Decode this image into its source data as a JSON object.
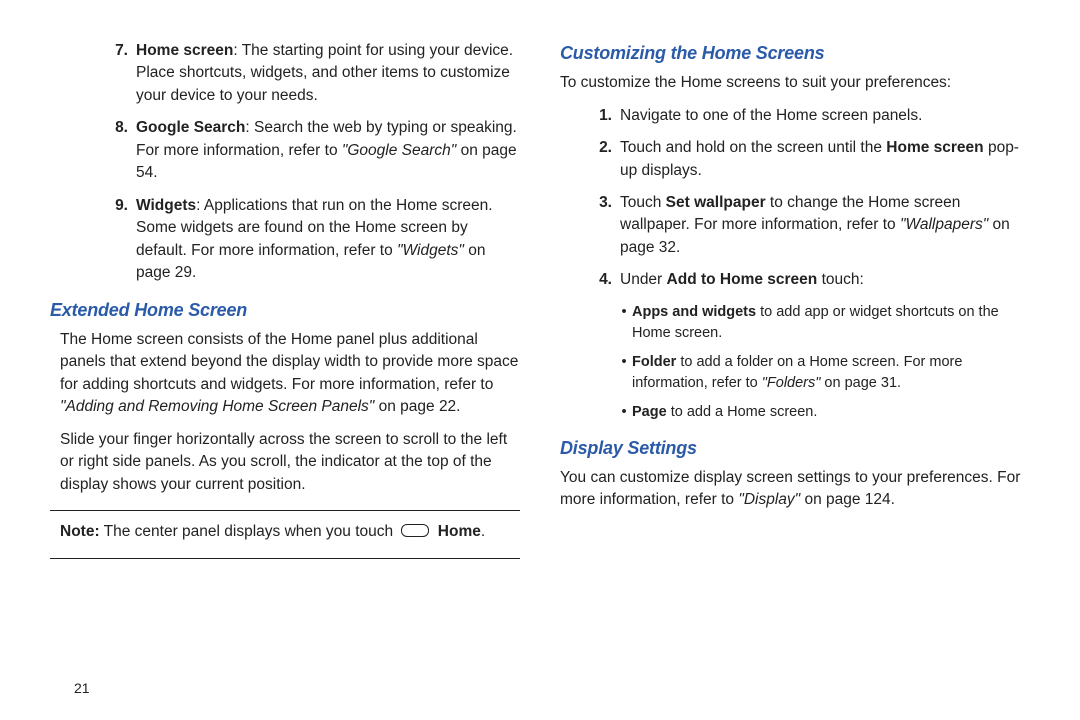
{
  "left": {
    "items": [
      {
        "num": "7.",
        "term": "Home screen",
        "text": ": The starting point for using your device. Place shortcuts, widgets, and other items to customize your device to your needs."
      },
      {
        "num": "8.",
        "term": "Google Search",
        "text1": ": Search the web by typing or speaking. For more information, refer to ",
        "ref": "\"Google Search\"",
        "text2": " on page 54."
      },
      {
        "num": "9.",
        "term": "Widgets",
        "text1": ": Applications that run on the Home screen. Some widgets are found on the Home screen by default. For more information, refer to ",
        "ref": "\"Widgets\"",
        "text2": " on page 29."
      }
    ],
    "h_extended": "Extended Home Screen",
    "p_ext1a": "The Home screen consists of the Home panel plus additional panels that extend beyond the display width to provide more space for adding shortcuts and widgets. For more information, refer to ",
    "p_ext1_ref": "\"Adding and Removing Home Screen Panels\"",
    "p_ext1b": " on page 22.",
    "p_ext2": "Slide your finger horizontally across the screen to scroll to the left or right side panels. As you scroll, the indicator at the top of the display shows your current position.",
    "note_label": "Note:",
    "note_text1": " The center panel displays when you touch ",
    "note_home": "Home",
    "note_text2": "."
  },
  "right": {
    "h_custom": "Customizing the Home Screens",
    "p_custom_intro": "To customize the Home screens to suit your preferences:",
    "steps": [
      {
        "num": "1.",
        "text": "Navigate to one of the Home screen panels."
      },
      {
        "num": "2.",
        "t1": "Touch and hold on the screen until the ",
        "b": "Home screen",
        "t2": " pop-up displays."
      },
      {
        "num": "3.",
        "t1": "Touch ",
        "b": "Set wallpaper",
        "t2": " to change the Home screen wallpaper. For more information, refer to ",
        "ref": "\"Wallpapers\"",
        "t3": " on page 32."
      },
      {
        "num": "4.",
        "t1": "Under ",
        "b": "Add to Home screen",
        "t2": " touch:"
      }
    ],
    "bullets": [
      {
        "b": "Apps and widgets",
        "t": " to add app or widget shortcuts on the Home screen."
      },
      {
        "b": "Folder",
        "t1": " to add a folder on a Home screen. For more information, refer to ",
        "ref": "\"Folders\"",
        "t2": " on page 31."
      },
      {
        "b": "Page",
        "t": " to add a Home screen."
      }
    ],
    "h_display": "Display Settings",
    "p_display1": "You can customize display screen settings to your preferences. For more information, refer to ",
    "p_display_ref": "\"Display\"",
    "p_display2": " on page 124."
  },
  "page_number": "21"
}
